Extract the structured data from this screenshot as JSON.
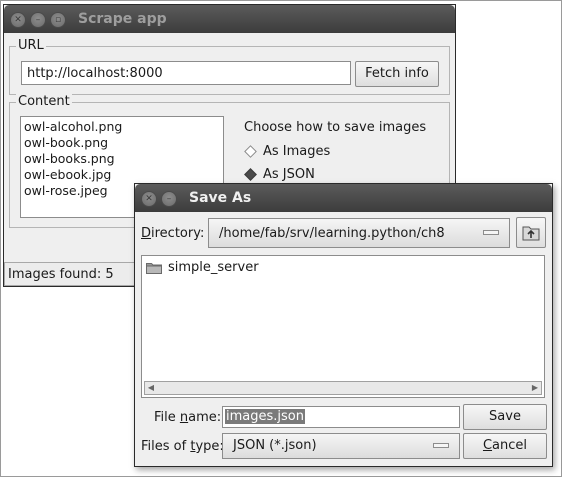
{
  "scrape_window": {
    "title": "Scrape app",
    "url_group_label": "URL",
    "url_value": "http://localhost:8000",
    "fetch_button": "Fetch info",
    "content_group_label": "Content",
    "images": [
      "owl-alcohol.png",
      "owl-book.png",
      "owl-books.png",
      "owl-ebook.jpg",
      "owl-rose.jpeg"
    ],
    "save_prompt": "Choose how to save images",
    "options": [
      {
        "label": "As Images",
        "selected": false
      },
      {
        "label": "As JSON",
        "selected": true
      }
    ],
    "status": "Images found: 5"
  },
  "save_dialog": {
    "title": "Save As",
    "directory_label": "Directory:",
    "directory_value": "/home/fab/srv/learning.python/ch8",
    "folders": [
      "simple_server"
    ],
    "file_name_label": "File name:",
    "file_name_value": "images.json",
    "file_type_label": "Files of type:",
    "file_type_value": "JSON (*.json)",
    "save_button": "Save",
    "cancel_button": "Cancel"
  },
  "colors": {
    "titlebar": "#3c3c3c",
    "window_bg": "#efefef",
    "selection": "#7a7a7a"
  }
}
